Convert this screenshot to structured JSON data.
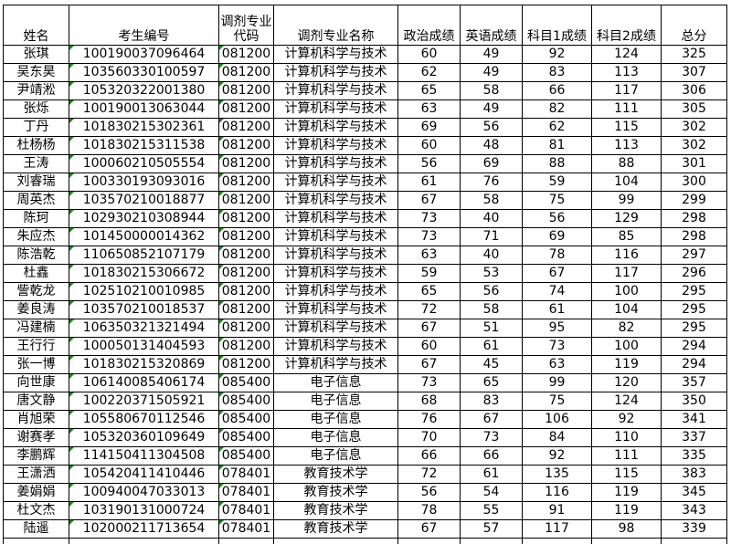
{
  "headers": {
    "name": "姓名",
    "id": "考生编号",
    "major_code": "调剂专业代码",
    "major_name": "调剂专业名称",
    "politics": "政治成绩",
    "english": "英语成绩",
    "subject1": "科目1成绩",
    "subject2": "科目2成绩",
    "total": "总分"
  },
  "rows": [
    [
      "张琪",
      "100190037096464",
      "081200",
      "计算机科学与技术",
      "60",
      "49",
      "92",
      "124",
      "325"
    ],
    [
      "吴东昊",
      "103560330100597",
      "081200",
      "计算机科学与技术",
      "62",
      "49",
      "83",
      "113",
      "307"
    ],
    [
      "尹靖淞",
      "105320322001380",
      "081200",
      "计算机科学与技术",
      "65",
      "58",
      "66",
      "117",
      "306"
    ],
    [
      "张烁",
      "100190013063044",
      "081200",
      "计算机科学与技术",
      "63",
      "49",
      "82",
      "111",
      "305"
    ],
    [
      "丁丹",
      "101830215302361",
      "081200",
      "计算机科学与技术",
      "69",
      "56",
      "62",
      "115",
      "302"
    ],
    [
      "杜杨杨",
      "101830215311538",
      "081200",
      "计算机科学与技术",
      "60",
      "48",
      "81",
      "113",
      "302"
    ],
    [
      "王涛",
      "100060210505554",
      "081200",
      "计算机科学与技术",
      "56",
      "69",
      "88",
      "88",
      "301"
    ],
    [
      "刘睿瑞",
      "100330193093016",
      "081200",
      "计算机科学与技术",
      "61",
      "76",
      "59",
      "104",
      "300"
    ],
    [
      "周英杰",
      "103570210018877",
      "081200",
      "计算机科学与技术",
      "67",
      "58",
      "75",
      "99",
      "299"
    ],
    [
      "陈珂",
      "102930210308944",
      "081200",
      "计算机科学与技术",
      "73",
      "40",
      "56",
      "129",
      "298"
    ],
    [
      "朱应杰",
      "101450000014362",
      "081200",
      "计算机科学与技术",
      "73",
      "71",
      "69",
      "85",
      "298"
    ],
    [
      "陈浩乾",
      "110650852107179",
      "081200",
      "计算机科学与技术",
      "63",
      "40",
      "78",
      "116",
      "297"
    ],
    [
      "杜鑫",
      "101830215306672",
      "081200",
      "计算机科学与技术",
      "59",
      "53",
      "67",
      "117",
      "296"
    ],
    [
      "訾乾龙",
      "102510210010985",
      "081200",
      "计算机科学与技术",
      "65",
      "56",
      "74",
      "100",
      "295"
    ],
    [
      "姜良涛",
      "103570210018537",
      "081200",
      "计算机科学与技术",
      "72",
      "58",
      "61",
      "104",
      "295"
    ],
    [
      "冯建楠",
      "106350321321494",
      "081200",
      "计算机科学与技术",
      "67",
      "51",
      "95",
      "82",
      "295"
    ],
    [
      "王行行",
      "100050131404593",
      "081200",
      "计算机科学与技术",
      "60",
      "61",
      "73",
      "100",
      "294"
    ],
    [
      "张一博",
      "101830215320869",
      "081200",
      "计算机科学与技术",
      "67",
      "45",
      "63",
      "119",
      "294"
    ],
    [
      "向世康",
      "106140085406174",
      "085400",
      "电子信息",
      "73",
      "65",
      "99",
      "120",
      "357"
    ],
    [
      "唐文静",
      "100220371505921",
      "085400",
      "电子信息",
      "68",
      "83",
      "75",
      "124",
      "350"
    ],
    [
      "肖旭荣",
      "105580670112546",
      "085400",
      "电子信息",
      "76",
      "67",
      "106",
      "92",
      "341"
    ],
    [
      "谢赛孝",
      "105320360109649",
      "085400",
      "电子信息",
      "70",
      "73",
      "84",
      "110",
      "337"
    ],
    [
      "李鹏辉",
      "114150411304508",
      "085400",
      "电子信息",
      "66",
      "66",
      "92",
      "111",
      "335"
    ],
    [
      "王潇洒",
      "105420411410446",
      "078401",
      "教育技术学",
      "72",
      "61",
      "135",
      "115",
      "383"
    ],
    [
      "姜娟娟",
      "100940047033013",
      "078401",
      "教育技术学",
      "56",
      "54",
      "116",
      "119",
      "345"
    ],
    [
      "杜文杰",
      "103190131000724",
      "078401",
      "教育技术学",
      "78",
      "55",
      "91",
      "119",
      "343"
    ],
    [
      "陆遥",
      "102000211713654",
      "078401",
      "教育技术学",
      "67",
      "57",
      "117",
      "98",
      "339"
    ]
  ]
}
